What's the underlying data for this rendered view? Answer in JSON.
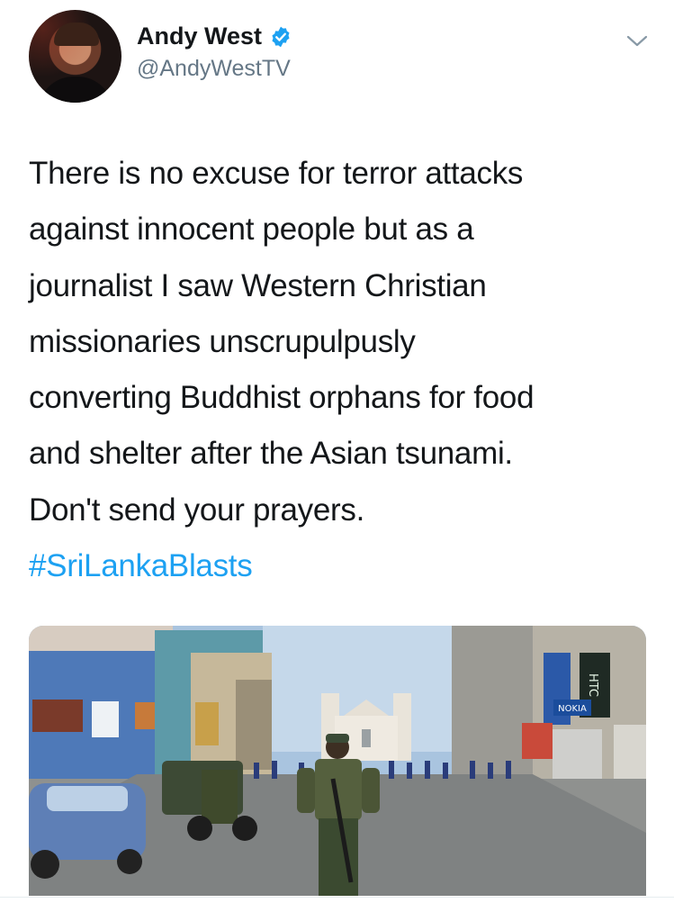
{
  "author": {
    "name": "Andy West",
    "handle": "@AndyWestTV",
    "verified_icon": "verified-badge-icon",
    "avatar_icon": "profile-photo"
  },
  "tweet": {
    "lines": [
      "There is no excuse for terror attacks",
      "against innocent people but as a",
      "journalist I saw Western Christian",
      "missionaries unscrupulpusly",
      "converting Buddhist orphans for food",
      "and shelter after the Asian tsunami.",
      "Don't send your prayers."
    ],
    "hashtag": "#SriLankaBlasts"
  },
  "menu_icon": "chevron-down-icon",
  "media": {
    "kind": "photo",
    "signs": {
      "htc": "HTC",
      "nokia": "NOKIA"
    }
  },
  "colors": {
    "text": "#14171a",
    "secondary": "#657786",
    "link": "#1da1f2",
    "verified": "#1da1f2"
  }
}
